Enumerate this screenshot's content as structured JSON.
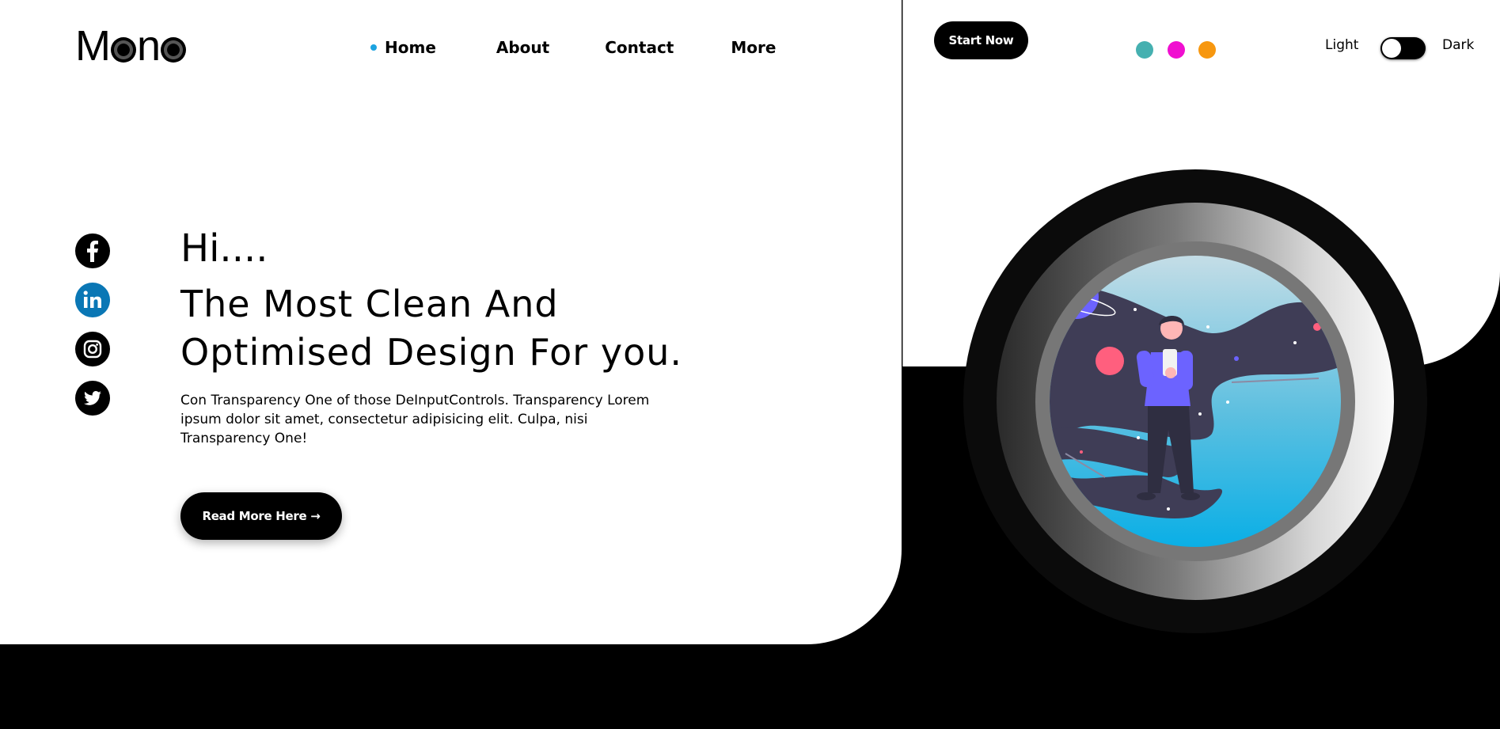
{
  "brand": {
    "logo_text_left": "M",
    "logo_text_right": "n"
  },
  "nav": {
    "items": [
      {
        "label": "Home",
        "active": true
      },
      {
        "label": "About"
      },
      {
        "label": "Contact"
      },
      {
        "label": "More"
      }
    ],
    "active_dot_color": "#1ca3e0"
  },
  "social": [
    {
      "name": "facebook-icon"
    },
    {
      "name": "linkedin-icon",
      "color": "#0a77b5"
    },
    {
      "name": "instagram-icon"
    },
    {
      "name": "twitter-icon"
    }
  ],
  "hero": {
    "greeting": "Hi....",
    "headline": "The Most Clean And Optimised Design For you.",
    "description": "Con Transparency One of those DeInputControls. Transparency Lorem ipsum dolor sit amet, consectetur adipisicing elit. Culpa, nisi Transparency One!",
    "cta_label": "Read More Here →"
  },
  "top_right": {
    "start_label": "Start Now",
    "swatches": [
      "#45b0b0",
      "#f00fd0",
      "#f7970f"
    ],
    "theme_light_label": "Light",
    "theme_dark_label": "Dark"
  }
}
